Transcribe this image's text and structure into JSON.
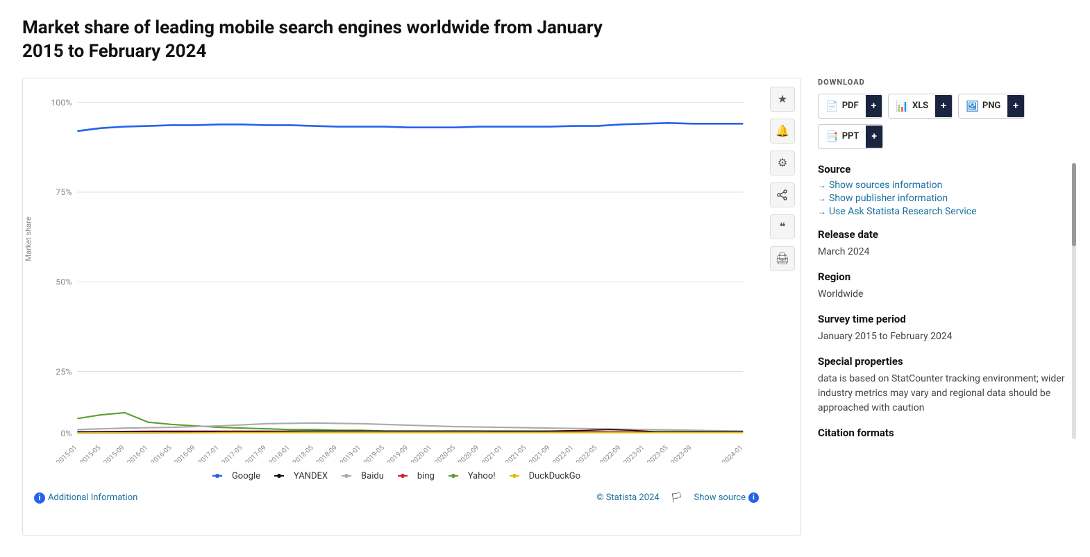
{
  "page": {
    "title": "Market share of leading mobile search engines worldwide from January 2015 to February 2024"
  },
  "toolbar": {
    "star_label": "★",
    "bell_label": "🔔",
    "gear_label": "⚙",
    "share_label": "⎘",
    "quote_label": "❝",
    "print_label": "🖨"
  },
  "download": {
    "label": "DOWNLOAD",
    "buttons": [
      {
        "id": "pdf",
        "label": "PDF",
        "icon": "pdf"
      },
      {
        "id": "xls",
        "label": "XLS",
        "icon": "xls"
      },
      {
        "id": "png",
        "label": "PNG",
        "icon": "png"
      },
      {
        "id": "ppt",
        "label": "PPT",
        "icon": "ppt"
      }
    ]
  },
  "source_section": {
    "title": "Source",
    "links": [
      {
        "id": "show-sources",
        "label": "Show sources information"
      },
      {
        "id": "show-publisher",
        "label": "Show publisher information"
      },
      {
        "id": "ask-statista",
        "label": "Use Ask Statista Research Service"
      }
    ]
  },
  "metadata": [
    {
      "id": "release-date",
      "title": "Release date",
      "value": "March 2024"
    },
    {
      "id": "region",
      "title": "Region",
      "value": "Worldwide"
    },
    {
      "id": "survey-period",
      "title": "Survey time period",
      "value": "January 2015 to February 2024"
    },
    {
      "id": "special-props",
      "title": "Special properties",
      "value": "data is based on StatCounter tracking environment; wider industry metrics may vary and regional data should be approached with caution"
    },
    {
      "id": "citation",
      "title": "Citation formats",
      "value": ""
    }
  ],
  "chart": {
    "y_axis_label": "Market share",
    "y_ticks": [
      "100%",
      "75%",
      "50%",
      "25%",
      "0%"
    ],
    "x_ticks": [
      "2015-01",
      "2015-05",
      "2015-09",
      "2016-01",
      "2016-05",
      "2016-09",
      "2017-01",
      "2017-05",
      "2017-09",
      "2018-01",
      "2018-05",
      "2018-09",
      "2019-01",
      "2019-05",
      "2019-09",
      "2020-01",
      "2020-05",
      "2020-09",
      "2021-01",
      "2021-05",
      "2021-09",
      "2022-01",
      "2022-05",
      "2022-09",
      "2023-01",
      "2023-05",
      "2023-09",
      "2024-01"
    ]
  },
  "legend": [
    {
      "id": "google",
      "label": "Google",
      "color": "#2563eb"
    },
    {
      "id": "yandex",
      "label": "YANDEX",
      "color": "#111"
    },
    {
      "id": "baidu",
      "label": "Baidu",
      "color": "#aaa"
    },
    {
      "id": "bing",
      "label": "bing",
      "color": "#cc2222"
    },
    {
      "id": "yahoo",
      "label": "Yahoo!",
      "color": "#5a9e2f"
    },
    {
      "id": "duckduckgo",
      "label": "DuckDuckGo",
      "color": "#e6b800"
    }
  ],
  "footer": {
    "additional_info": "Additional Information",
    "statista_credit": "© Statista 2024",
    "show_source": "Show source"
  }
}
